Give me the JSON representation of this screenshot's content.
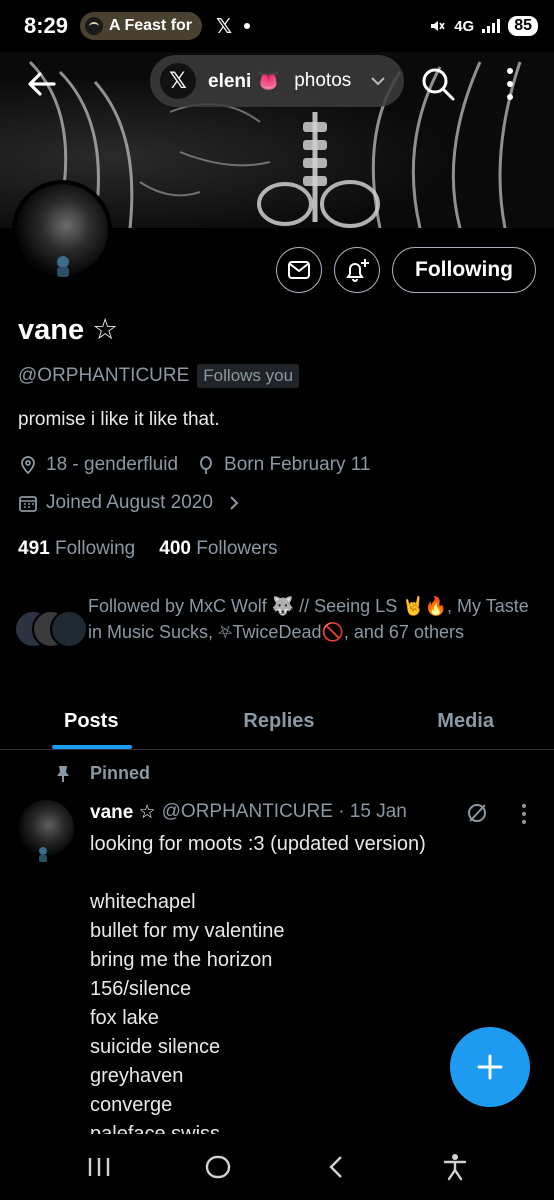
{
  "status_bar": {
    "time": "8:29",
    "media_title": "A Feast for",
    "app_letter": "𝕏",
    "network": "4G",
    "battery": "85"
  },
  "top_nav": {
    "pill_app_letter": "𝕏",
    "pill_name": "eleni 👅",
    "pill_section": "photos"
  },
  "profile": {
    "display_name": "vane ☆",
    "handle": "@ORPHANTICURE",
    "follows_you": "Follows you",
    "follow_button": "Following",
    "bio": "promise i like it like that.",
    "location": "18 - genderfluid",
    "born": "Born February 11",
    "joined": "Joined August 2020",
    "following_count": "491",
    "following_label": "Following",
    "followers_count": "400",
    "followers_label": "Followers",
    "followed_by": "Followed by MxC Wolf 🐺 // Seeing LS 🤘🔥, My Taste in Music Sucks, ⛧TwiceDead🚫, and 67 others"
  },
  "tabs": [
    {
      "label": "Posts",
      "active": true
    },
    {
      "label": "Replies",
      "active": false
    },
    {
      "label": "Media",
      "active": false
    }
  ],
  "post": {
    "pinned_label": "Pinned",
    "author": "vane ☆",
    "handle_date": "@ORPHANTICURE · 15 Jan",
    "lines": [
      "looking for moots :3 (updated version)",
      "",
      "whitechapel",
      "bullet for my valentine",
      "bring me the horizon",
      "156/silence",
      "fox lake",
      "suicide silence",
      "greyhaven",
      "converge",
      "paleface swiss"
    ]
  },
  "colors": {
    "accent": "#1d9bf0",
    "secondary_text": "#8b98a5",
    "background": "#000000"
  },
  "icons": {
    "back": "arrow-left-icon",
    "search": "search-icon",
    "more": "more-vertical-icon",
    "message": "envelope-icon",
    "notify": "bell-plus-icon",
    "location": "location-pin-icon",
    "birthday": "balloon-icon",
    "calendar": "calendar-icon",
    "pin": "pin-icon",
    "compose": "plus-icon"
  }
}
